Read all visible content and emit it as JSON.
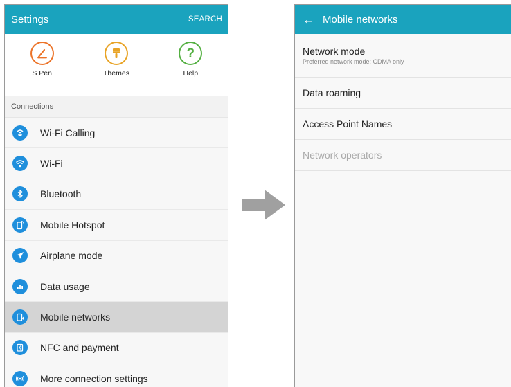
{
  "left": {
    "appbar": {
      "title": "Settings",
      "action": "SEARCH"
    },
    "quick": [
      {
        "label": "S Pen",
        "icon": "s-pen-icon",
        "color": "#ec7328"
      },
      {
        "label": "Themes",
        "icon": "themes-icon",
        "color": "#e8a325"
      },
      {
        "label": "Help",
        "icon": "help-icon",
        "color": "#55b043"
      }
    ],
    "section": "Connections",
    "items": [
      {
        "label": "Wi-Fi Calling",
        "icon": "wifi-calling-icon"
      },
      {
        "label": "Wi-Fi",
        "icon": "wifi-icon"
      },
      {
        "label": "Bluetooth",
        "icon": "bluetooth-icon"
      },
      {
        "label": "Mobile Hotspot",
        "icon": "hotspot-icon"
      },
      {
        "label": "Airplane mode",
        "icon": "airplane-icon"
      },
      {
        "label": "Data usage",
        "icon": "data-usage-icon"
      },
      {
        "label": "Mobile networks",
        "icon": "mobile-networks-icon",
        "selected": true
      },
      {
        "label": "NFC and payment",
        "icon": "nfc-icon"
      },
      {
        "label": "More connection settings",
        "icon": "more-connections-icon"
      }
    ]
  },
  "right": {
    "appbar": {
      "title": "Mobile networks",
      "back_icon": "arrow-left-icon"
    },
    "rows": [
      {
        "label": "Network mode",
        "sub": "Preferred network mode: CDMA only"
      },
      {
        "label": "Data roaming"
      },
      {
        "label": "Access Point Names"
      },
      {
        "label": "Network operators",
        "disabled": true
      }
    ]
  },
  "transition": {
    "icon": "arrow-right-icon",
    "color": "#a0a0a0"
  },
  "colors": {
    "appbar": "#1aa3be",
    "list_icon": "#1f8fdc",
    "selected_row": "#d4d4d4"
  }
}
